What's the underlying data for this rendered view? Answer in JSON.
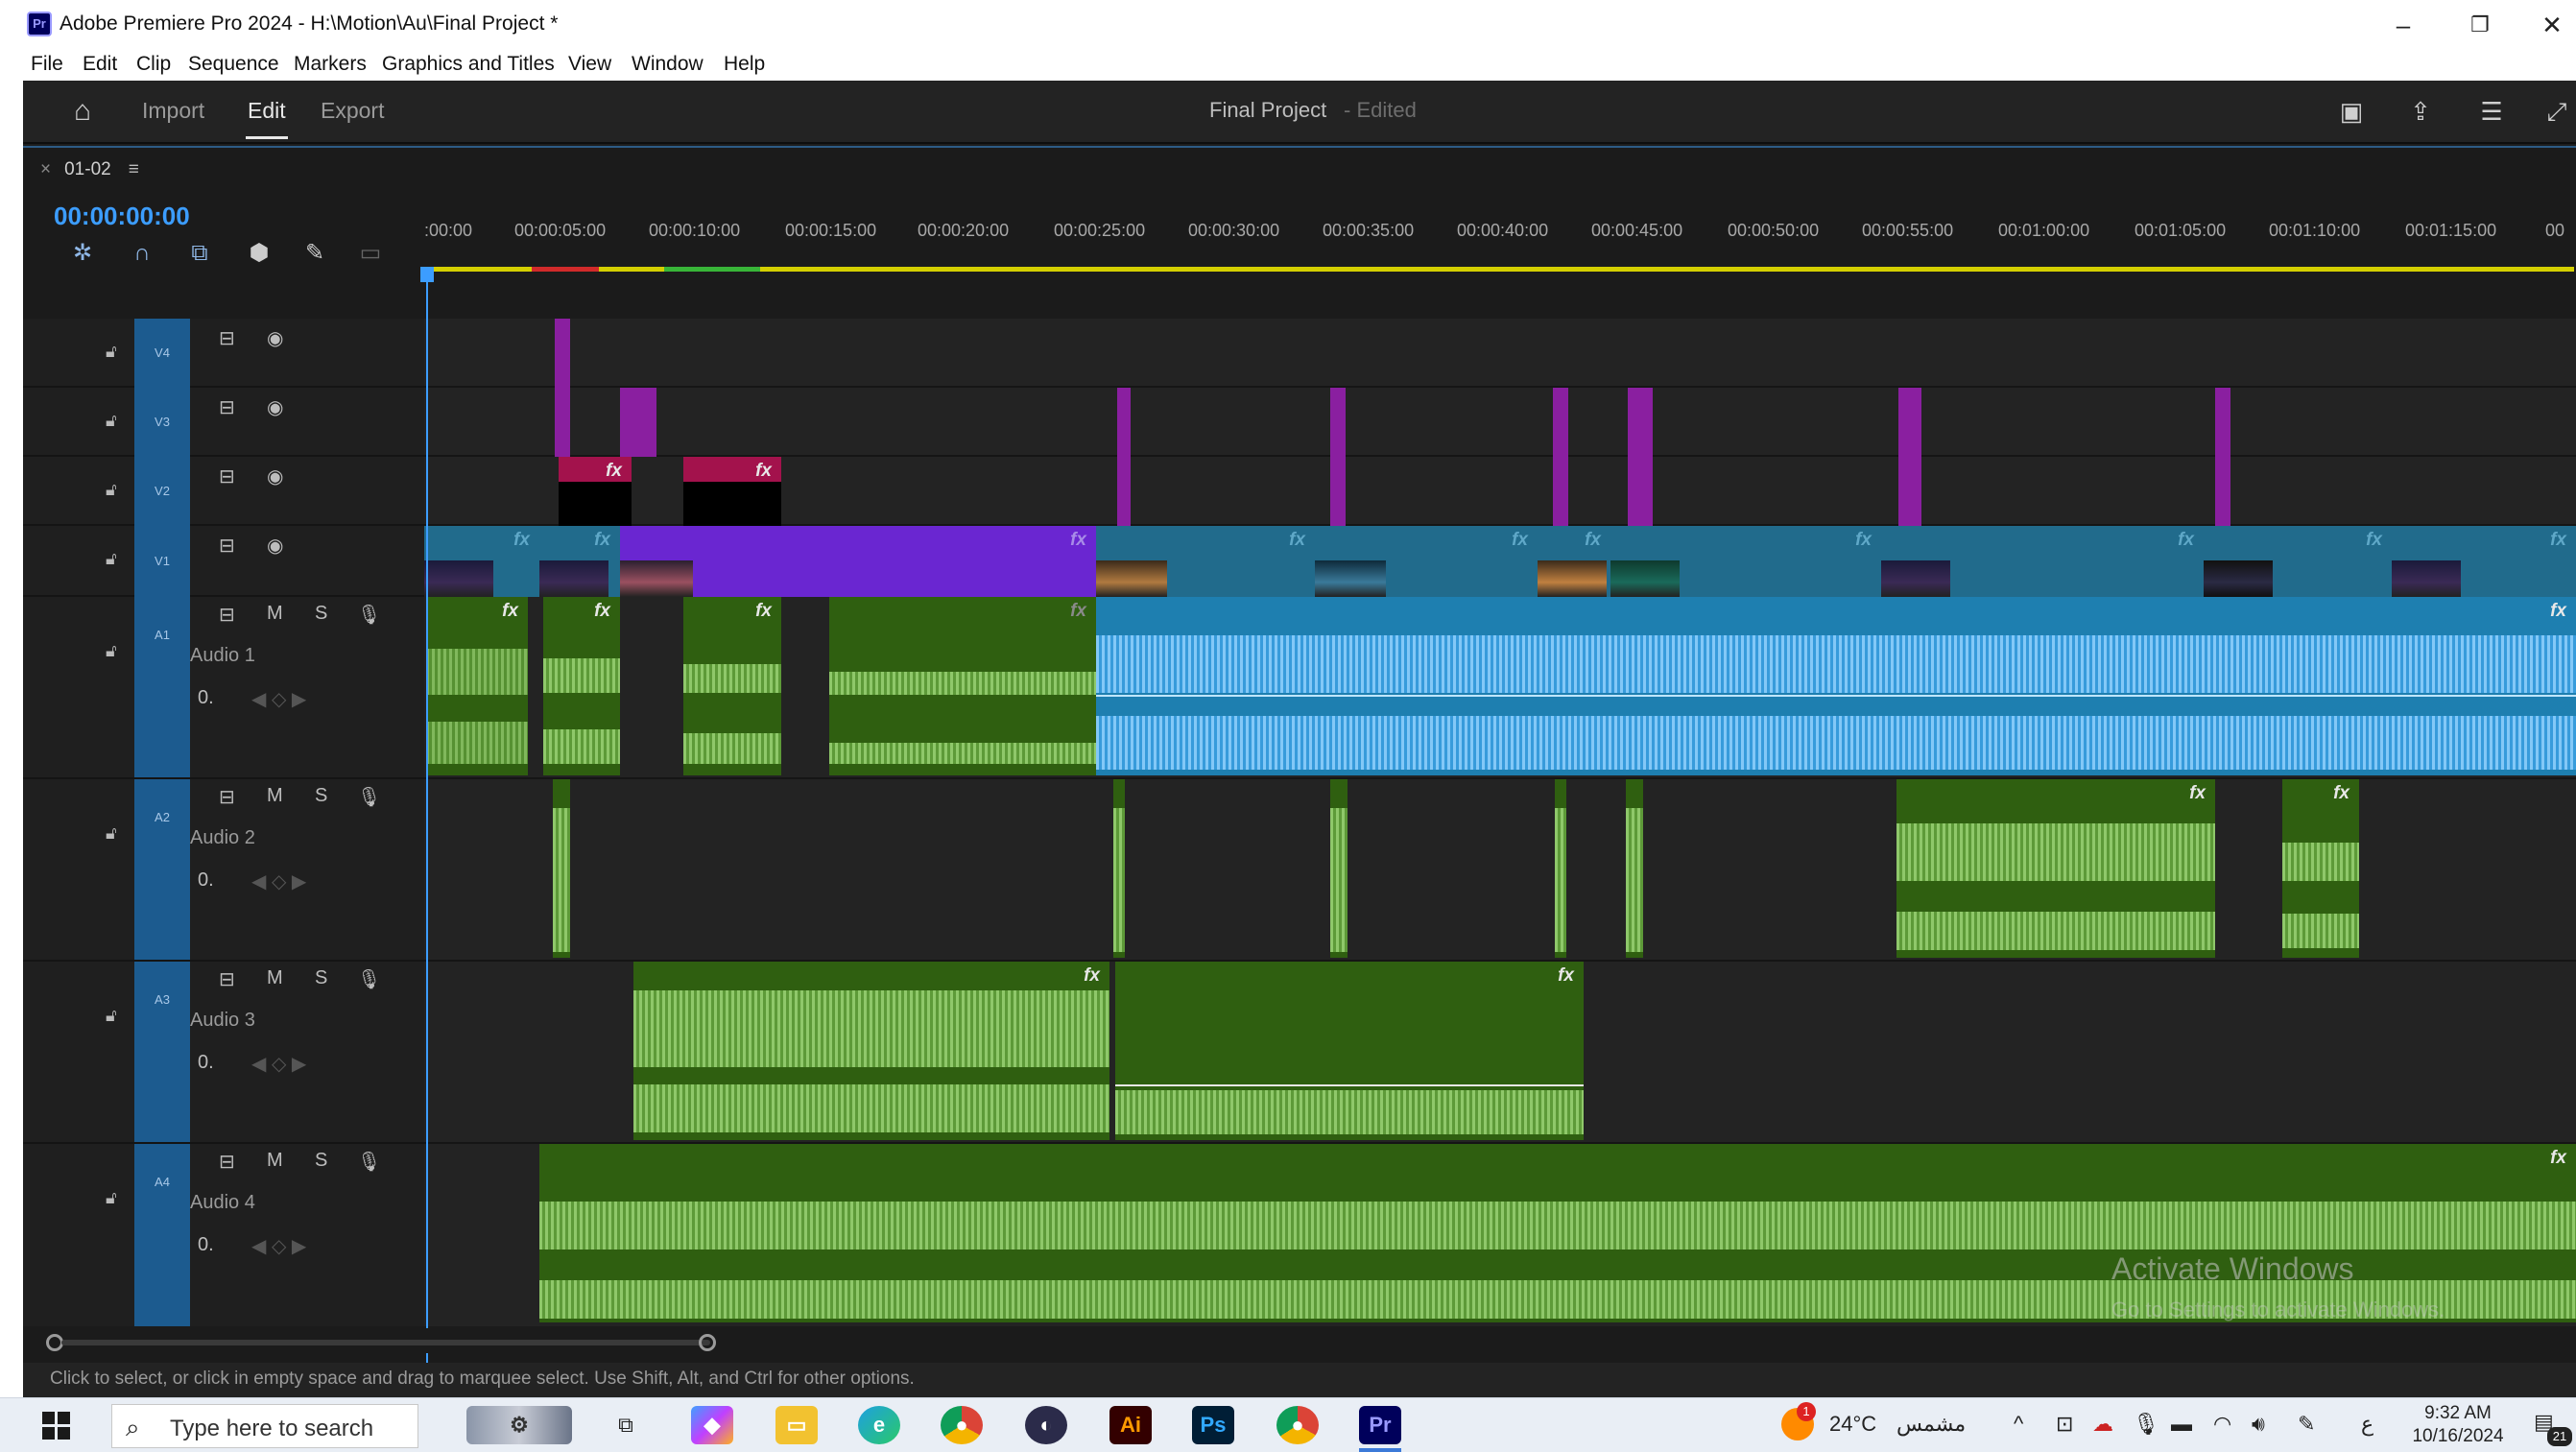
{
  "window": {
    "title": "Adobe Premiere Pro 2024 - H:\\Motion\\Au\\Final Project *",
    "app_icon": "Pr"
  },
  "menu": [
    "File",
    "Edit",
    "Clip",
    "Sequence",
    "Markers",
    "Graphics and Titles",
    "View",
    "Window",
    "Help"
  ],
  "workspaces": {
    "import": "Import",
    "edit": "Edit",
    "export": "Export"
  },
  "project": {
    "name": "Final Project",
    "state": "- Edited"
  },
  "sequence": {
    "name": "01-02",
    "timecode": "00:00:00:00"
  },
  "ruler_ticks": [
    ":00:00",
    "00:00:05:00",
    "00:00:10:00",
    "00:00:15:00",
    "00:00:20:00",
    "00:00:25:00",
    "00:00:30:00",
    "00:00:35:00",
    "00:00:40:00",
    "00:00:45:00",
    "00:00:50:00",
    "00:00:55:00",
    "00:01:00:00",
    "00:01:05:00",
    "00:01:10:00",
    "00:01:15:00",
    "00"
  ],
  "video_tracks": [
    {
      "id": "V4"
    },
    {
      "id": "V3"
    },
    {
      "id": "V2"
    },
    {
      "id": "V1"
    }
  ],
  "audio_tracks": [
    {
      "id": "A1",
      "name": "Audio 1",
      "mute": "M",
      "solo": "S",
      "volume": "0."
    },
    {
      "id": "A2",
      "name": "Audio 2",
      "mute": "M",
      "solo": "S",
      "volume": "0."
    },
    {
      "id": "A3",
      "name": "Audio 3",
      "mute": "M",
      "solo": "S",
      "volume": "0."
    },
    {
      "id": "A4",
      "name": "Audio 4",
      "mute": "M",
      "solo": "S",
      "volume": "0."
    }
  ],
  "clip_fx_label": "fx",
  "watermark": {
    "line1": "Activate Windows",
    "line2": "Go to Settings to activate Windows."
  },
  "status_text": "Click to select, or click in empty space and drag to marquee select. Use Shift, Alt, and Ctrl for other options.",
  "taskbar": {
    "search_placeholder": "Type here to search",
    "apps": [
      "Ai",
      "Ps",
      "Pr"
    ],
    "weather": "24°C",
    "weather_desc": "مشمس",
    "lang": "ع",
    "time": "9:32 AM",
    "date": "10/16/2024",
    "notification_count": "21",
    "weather_badge": "1"
  },
  "colors": {
    "accent": "#3c9dff",
    "video_clip": "#216b8c",
    "audio_clip": "#2f5f10",
    "nested_audio": "#1e7fb0",
    "adjustment": "#8a1fa0"
  }
}
